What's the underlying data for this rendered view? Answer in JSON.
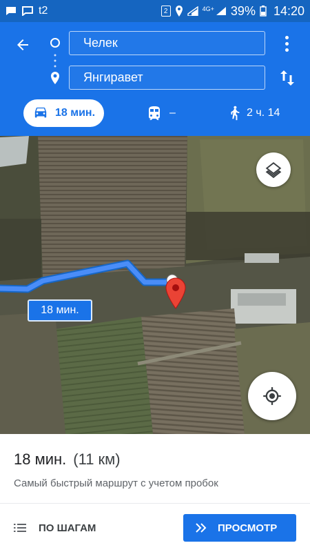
{
  "status_bar": {
    "carrier": "t2",
    "network": "4G+",
    "sim_badge": "2",
    "battery": "39%",
    "time": "14:20",
    "icons": [
      "chat-icon",
      "message-icon",
      "sim2-icon",
      "location-icon",
      "wifi-icon",
      "signal-icon",
      "battery-icon"
    ]
  },
  "directions": {
    "from": "Челек",
    "to": "Янгиравет",
    "modes": {
      "car": "18 мин.",
      "transit": "–",
      "walk": "2 ч. 14"
    }
  },
  "map": {
    "route_label": "18 мин.",
    "route_color": "#4a8df8",
    "pin_color": "#ea4335"
  },
  "sheet": {
    "duration": "18 мин.",
    "distance": "(11 км)",
    "description": "Самый быстрый маршрут с учетом пробок",
    "steps_label": "ПО ШАГАМ",
    "preview_label": "ПРОСМОТР"
  },
  "colors": {
    "header": "#1a73e8",
    "status_bar": "#1565c0",
    "accent": "#1a73e8"
  }
}
